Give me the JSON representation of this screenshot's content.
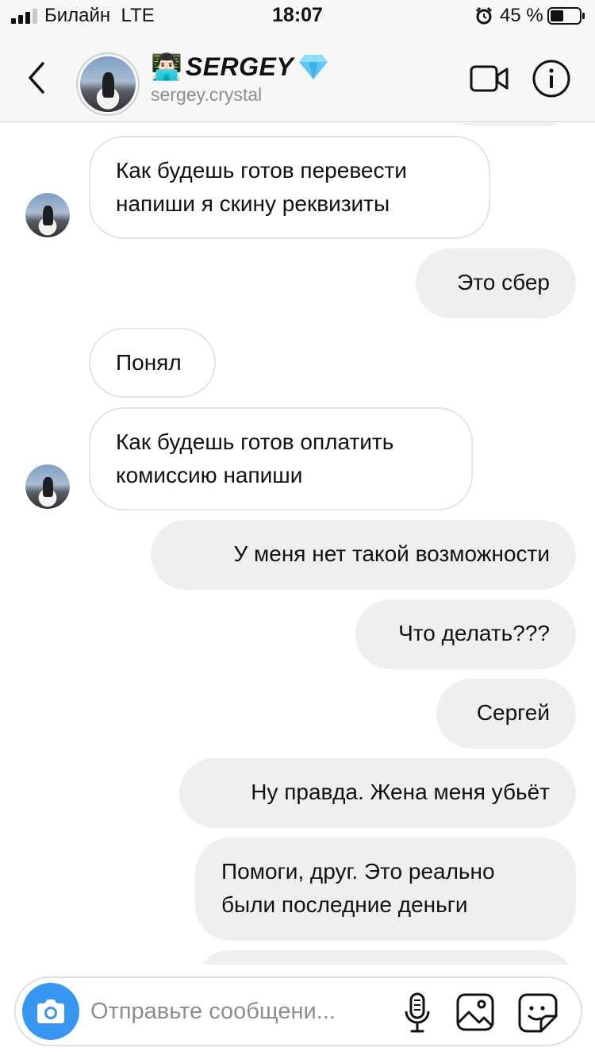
{
  "status_bar": {
    "carrier": "Билайн",
    "network": "LTE",
    "time": "18:07",
    "battery_text": "45 %",
    "battery_level": 0.45
  },
  "header": {
    "emoji": "👨🏻‍💻",
    "name": "SERGEY",
    "username": "sergey.crystal",
    "icons": [
      "back-icon",
      "video-call-icon",
      "info-icon",
      "diamond-icon"
    ]
  },
  "messages": [
    {
      "side": "in",
      "lines": [
        "Как будешь готов перевести",
        "напиши я скину реквизиты"
      ],
      "avatar": true
    },
    {
      "side": "out",
      "lines": [
        "Это сбер"
      ]
    },
    {
      "side": "in",
      "lines": [
        "Понял"
      ],
      "avatar": false
    },
    {
      "side": "in",
      "lines": [
        "Как будешь готов оплатить",
        "комиссию напиши"
      ],
      "avatar": true
    },
    {
      "side": "out",
      "lines": [
        "У меня нет такой возможности"
      ]
    },
    {
      "side": "out",
      "lines": [
        "Что делать???"
      ]
    },
    {
      "side": "out",
      "lines": [
        "Сергей"
      ]
    },
    {
      "side": "out",
      "lines": [
        "Ну правда. Жена меня убьёт"
      ]
    },
    {
      "side": "out",
      "lines": [
        "Помоги, друг. Это реально",
        "были последние деньги"
      ]
    }
  ],
  "composer": {
    "placeholder": "Отправьте сообщени...",
    "icons": [
      "camera-icon",
      "microphone-icon",
      "gallery-icon",
      "sticker-icon"
    ]
  },
  "colors": {
    "accent": "#3797f0",
    "outgoing_bubble": "#efefef",
    "incoming_border": "#e4e4e4",
    "secondary_text": "#8e8e8e"
  }
}
